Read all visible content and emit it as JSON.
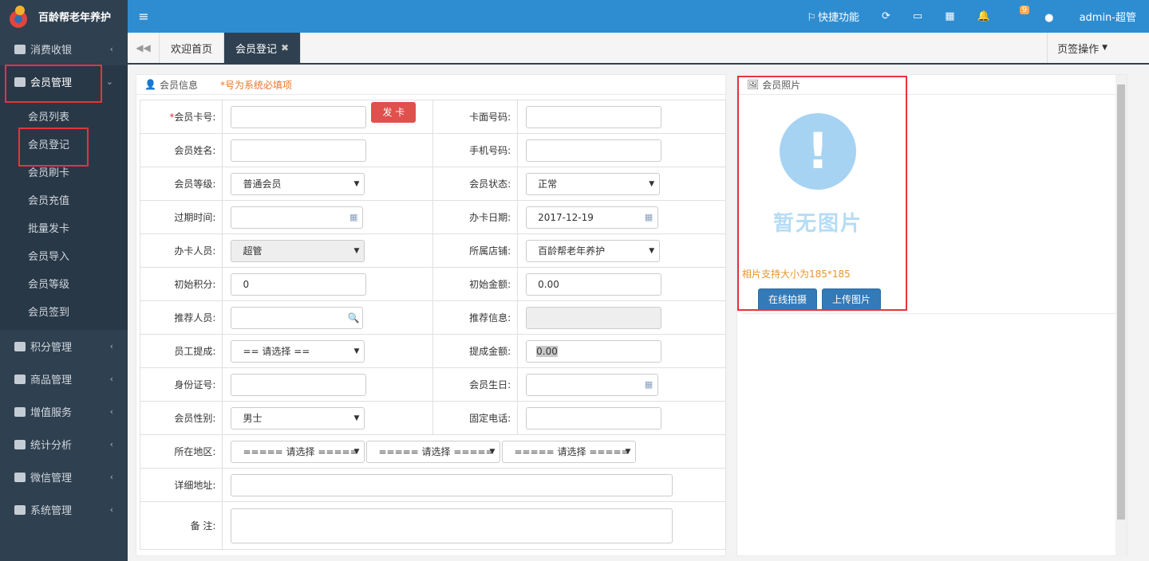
{
  "app": {
    "title": "百龄帮老年养护"
  },
  "sidebar": {
    "items": [
      {
        "label": "消费收银"
      },
      {
        "label": "会员管理"
      },
      {
        "label": "积分管理"
      },
      {
        "label": "商品管理"
      },
      {
        "label": "增值服务"
      },
      {
        "label": "统计分析"
      },
      {
        "label": "微信管理"
      },
      {
        "label": "系统管理"
      }
    ],
    "sub_items": [
      "会员列表",
      "会员登记",
      "会员刷卡",
      "会员充值",
      "批量发卡",
      "会员导入",
      "会员等级",
      "会员签到"
    ]
  },
  "topbar": {
    "shortcut": "快捷功能",
    "badge": "9",
    "user": "admin-超管"
  },
  "tabs": {
    "home": "欢迎首页",
    "current": "会员登记",
    "ops": "页签操作"
  },
  "form": {
    "title": "会员信息",
    "required_note": "*号为系统必填项",
    "card_no_label": "会员卡号:",
    "issue_button": "发 卡",
    "face_no_label": "卡面号码:",
    "name_label": "会员姓名:",
    "phone_label": "手机号码:",
    "level_label": "会员等级:",
    "level_value": "普通会员",
    "status_label": "会员状态:",
    "status_value": "正常",
    "expire_label": "过期时间:",
    "issue_date_label": "办卡日期:",
    "issue_date_value": "2017-12-19",
    "staff_label": "办卡人员:",
    "staff_value": "超管",
    "store_label": "所属店铺:",
    "store_value": "百龄帮老年养护",
    "points_label": "初始积分:",
    "points_value": "0",
    "amount_label": "初始金额:",
    "amount_value": "0.00",
    "referrer_label": "推荐人员:",
    "referrer_info_label": "推荐信息:",
    "commission_label": "员工提成:",
    "commission_value": "== 请选择 ==",
    "commission_amount_label": "提成金额:",
    "commission_amount_value": "0.00",
    "id_label": "身份证号:",
    "birthday_label": "会员生日:",
    "gender_label": "会员性别:",
    "gender_value": "男士",
    "tel_label": "固定电话:",
    "region_label": "所在地区:",
    "region_placeholder": "===== 请选择 =====",
    "address_label": "详细地址:",
    "remark_label": "备 注:"
  },
  "photo": {
    "title": "会员照片",
    "no_image": "暂无图片",
    "size_note": "相片支持大小为185*185",
    "capture_button": "在线拍摄",
    "upload_button": "上传图片"
  }
}
